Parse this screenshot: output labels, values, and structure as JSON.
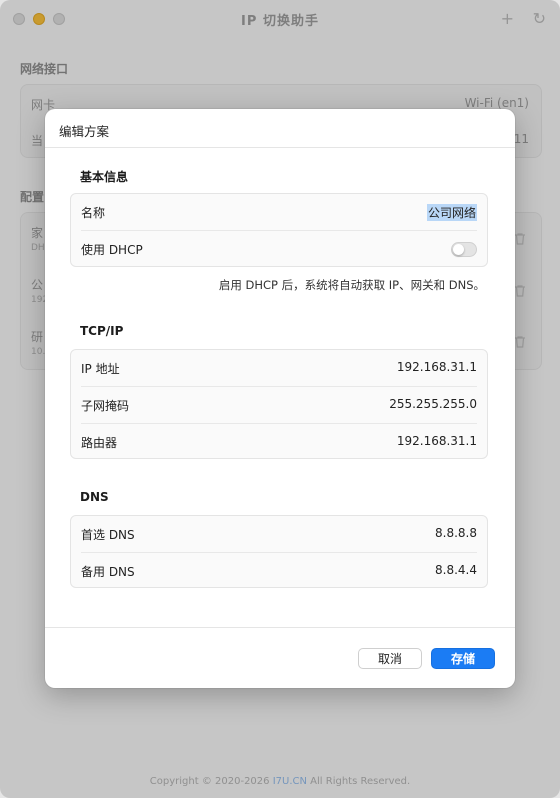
{
  "window": {
    "title": "IP 切换助手",
    "add_glyph": "+",
    "refresh_glyph": "↻"
  },
  "background": {
    "interface_section": "网络接口",
    "nic_label": "网卡",
    "nic_value": "Wi-Fi (en1)",
    "current_label": "当",
    "current_value": "11",
    "config_section": "配置",
    "profiles": [
      {
        "name": "家",
        "sub": "DHC"
      },
      {
        "name": "公",
        "sub": "192"
      },
      {
        "name": "研",
        "sub": "10."
      }
    ]
  },
  "footer": {
    "copyright": "Copyright © 2020-2026 ",
    "link": "I7U.CN",
    "rights": " All Rights Reserved."
  },
  "modal": {
    "title": "编辑方案",
    "basic": {
      "section_title": "基本信息",
      "name_label": "名称",
      "name_value": "公司网络",
      "dhcp_label": "使用 DHCP",
      "dhcp_enabled": false,
      "hint": "启用 DHCP 后，系统将自动获取 IP、网关和 DNS。"
    },
    "tcpip": {
      "section_title": "TCP/IP",
      "ip_label": "IP 地址",
      "ip_value": "192.168.31.1",
      "mask_label": "子网掩码",
      "mask_value": "255.255.255.0",
      "router_label": "路由器",
      "router_value": "192.168.31.1"
    },
    "dns": {
      "section_title": "DNS",
      "primary_label": "首选 DNS",
      "primary_value": "8.8.8.8",
      "secondary_label": "备用 DNS",
      "secondary_value": "8.8.4.4"
    },
    "buttons": {
      "cancel": "取消",
      "save": "存储"
    }
  },
  "colors": {
    "accent": "#1b7cf4",
    "selection": "#b9d7f7",
    "minimize": "#f6bd3a"
  }
}
